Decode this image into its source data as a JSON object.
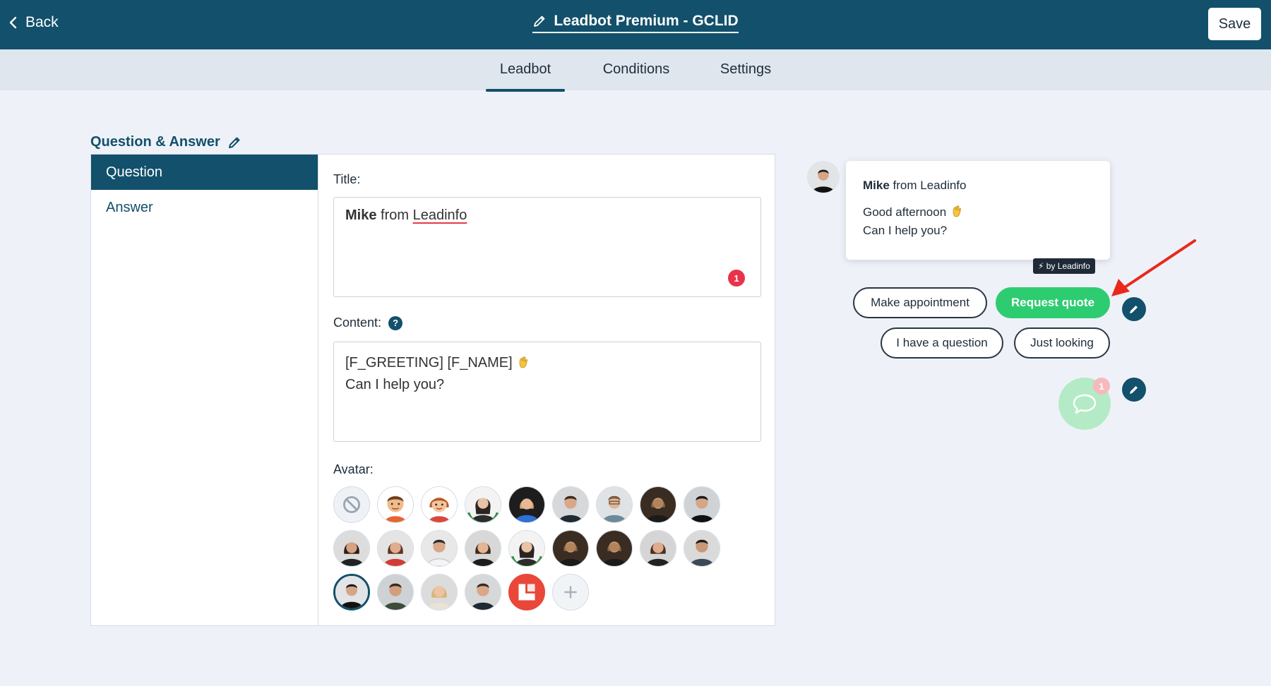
{
  "header": {
    "back_label": "Back",
    "title": "Leadbot Premium - GCLID",
    "save_label": "Save"
  },
  "tabs": [
    {
      "label": "Leadbot",
      "active": true
    },
    {
      "label": "Conditions",
      "active": false
    },
    {
      "label": "Settings",
      "active": false
    }
  ],
  "section": {
    "title": "Question & Answer"
  },
  "sidenav": [
    {
      "label": "Question",
      "active": true
    },
    {
      "label": "Answer",
      "active": false
    }
  ],
  "form": {
    "title_label": "Title:",
    "title_value_bold": "Mike",
    "title_value_from": "from",
    "title_value_company": "Leadinfo",
    "title_error_count": "1",
    "content_label": "Content:",
    "content_help": "?",
    "content_line1": "[F_GREETING] [F_NAME]",
    "content_line2": "Can I help you?",
    "avatar_label": "Avatar:"
  },
  "preview": {
    "sender_bold": "Mike",
    "sender_rest": "from Leadinfo",
    "greeting": "Good afternoon",
    "question": "Can I help you?",
    "by_badge": "⚡ by Leadinfo",
    "buttons": {
      "make_appointment": "Make appointment",
      "request_quote": "Request quote",
      "have_question": "I have a question",
      "just_looking": "Just looking"
    },
    "chat_count": "1"
  },
  "colors": {
    "brand": "#12506b",
    "accent_green": "#2ecc71",
    "error_red": "#e8334a",
    "annotation_arrow": "#e8291c"
  }
}
